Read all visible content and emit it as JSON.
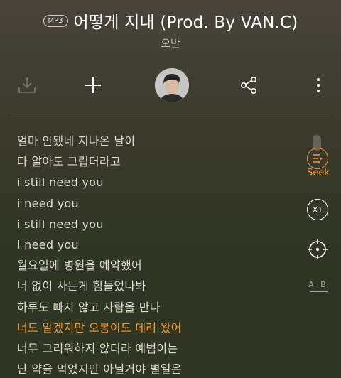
{
  "header": {
    "badge": "MP3",
    "title": "어떻게 지내 (Prod. By VAN.C)",
    "artist": "오반"
  },
  "toolbar": {
    "icons": [
      "download-icon",
      "add-icon",
      "artist-avatar",
      "share-icon",
      "more-icon"
    ]
  },
  "lyrics": [
    {
      "text": "얼마 안됐네 지나온 날이",
      "current": false
    },
    {
      "text": "다 알아도 그립더라고",
      "current": false
    },
    {
      "text": "i still need you",
      "current": false
    },
    {
      "text": "i need you",
      "current": false
    },
    {
      "text": "i still need you",
      "current": false
    },
    {
      "text": "i need you",
      "current": false
    },
    {
      "text": "월요일에 병원을 예약했어",
      "current": false
    },
    {
      "text": "너 없이 사는게 힘들었나봐",
      "current": false
    },
    {
      "text": "하루도 빠지 않고 사람을 만나",
      "current": false
    },
    {
      "text": "너도 알겠지만 오봉이도 데려 왔어",
      "current": true
    },
    {
      "text": "너무 그리워하지 않더라 예범이는",
      "current": false
    },
    {
      "text": "난 약을 먹었지만 아닐거야 별일은",
      "current": false
    }
  ],
  "side": {
    "seek_label": "Seek",
    "speed_label": "X1",
    "ab_label": "A B"
  },
  "colors": {
    "accent": "#f39a3c",
    "text": "#dedcd3"
  }
}
